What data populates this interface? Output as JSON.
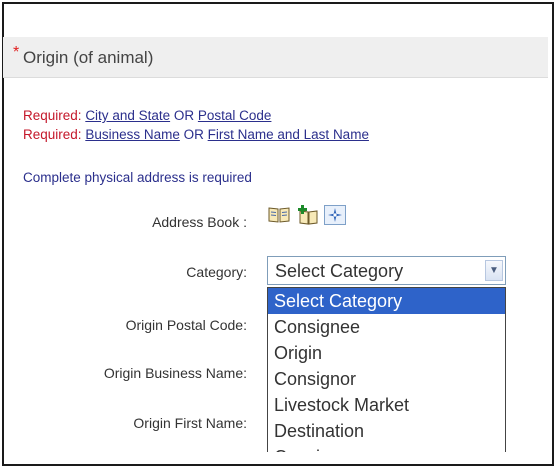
{
  "header": {
    "required_star": "*",
    "title": "Origin (of animal)"
  },
  "requirements": {
    "row1": {
      "prefix": "Required:",
      "link1": "City and State",
      "or": "OR",
      "link2": "Postal Code"
    },
    "row2": {
      "prefix": "Required:",
      "link1": "Business Name",
      "or": "OR",
      "link2": "First Name and Last Name"
    },
    "note": "Complete physical address is required"
  },
  "form": {
    "address_book_label": "Address Book :",
    "address_book_icons": [
      "book-icon",
      "add-contact-icon",
      "locate-icon"
    ],
    "category_label": "Category:",
    "category_select": {
      "value": "Select Category"
    },
    "origin_postal_code_label": "Origin Postal Code:",
    "origin_business_name_label": "Origin Business Name:",
    "origin_first_name_label": "Origin First Name:"
  },
  "category_options": [
    {
      "label": "Select Category",
      "selected": true
    },
    {
      "label": "Consignee",
      "selected": false
    },
    {
      "label": "Origin",
      "selected": false
    },
    {
      "label": "Consignor",
      "selected": false
    },
    {
      "label": "Livestock Market",
      "selected": false
    },
    {
      "label": "Destination",
      "selected": false
    },
    {
      "label": "Consignee",
      "selected": false
    }
  ],
  "colors": {
    "required": "#c4172a",
    "link": "#2b2f8c",
    "selected_bg": "#2e63c9"
  }
}
